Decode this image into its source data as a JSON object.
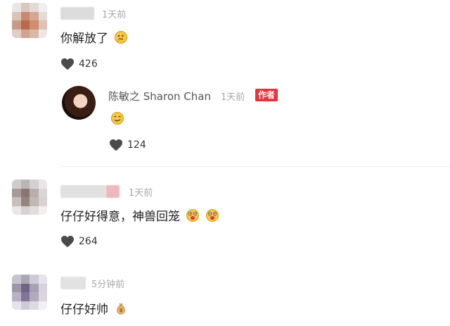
{
  "comments": [
    {
      "timestamp": "1天前",
      "text": "你解放了",
      "emoji": "thinking-face",
      "likes": "426",
      "reply": {
        "author_name": "陈敏之 Sharon Chan",
        "timestamp": "1天前",
        "author_badge": "作者",
        "emoji": "smirk-face",
        "likes": "124"
      }
    },
    {
      "timestamp": "1天前",
      "text": "仔仔好得意，神兽回笼",
      "emoji": "surprised-pig-face",
      "likes": "264"
    },
    {
      "timestamp": "5分钟前",
      "text": "仔仔好帅",
      "emoji": "money-bag"
    }
  ],
  "colors": {
    "badge": "#e8323c",
    "timestamp": "#a9a9a9",
    "like_icon": "#4a4a4a"
  }
}
